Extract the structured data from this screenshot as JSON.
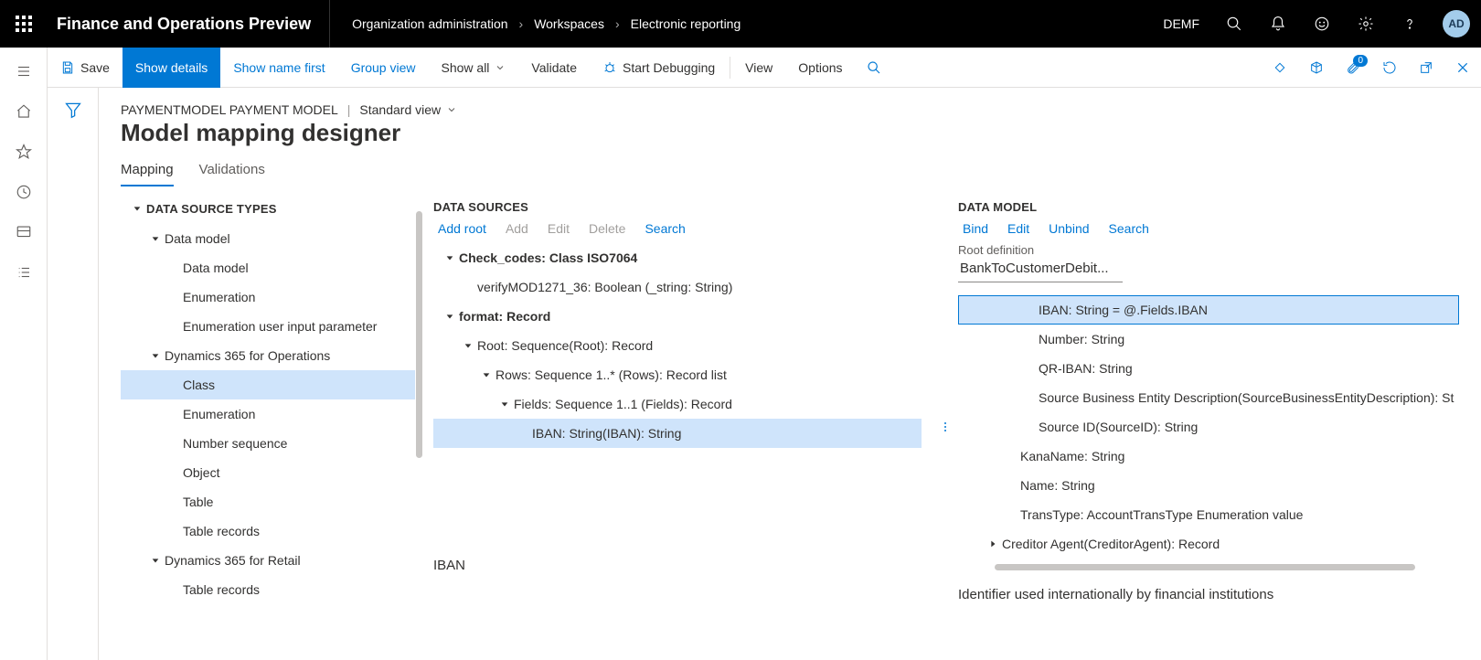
{
  "header": {
    "app_title": "Finance and Operations Preview",
    "breadcrumb": [
      "Organization administration",
      "Workspaces",
      "Electronic reporting"
    ],
    "entity": "DEMF",
    "avatar_initials": "AD"
  },
  "action_bar": {
    "save": "Save",
    "show_details": "Show details",
    "show_name_first": "Show name first",
    "group_view": "Group view",
    "show_all": "Show all",
    "validate": "Validate",
    "start_debugging": "Start Debugging",
    "view": "View",
    "options": "Options",
    "attach_badge": "0"
  },
  "page": {
    "breadcrumb_model": "PAYMENTMODEL PAYMENT MODEL",
    "view_label": "Standard view",
    "title": "Model mapping designer"
  },
  "tabs": {
    "mapping": "Mapping",
    "validations": "Validations"
  },
  "left_pane": {
    "title": "DATA SOURCE TYPES",
    "items": [
      {
        "indent": 1,
        "caret": "down",
        "bold": false,
        "label": "Data model"
      },
      {
        "indent": 2,
        "caret": "",
        "bold": false,
        "label": "Data model"
      },
      {
        "indent": 2,
        "caret": "",
        "bold": false,
        "label": "Enumeration"
      },
      {
        "indent": 2,
        "caret": "",
        "bold": false,
        "label": "Enumeration user input parameter"
      },
      {
        "indent": 1,
        "caret": "down",
        "bold": false,
        "label": "Dynamics 365 for Operations"
      },
      {
        "indent": 2,
        "caret": "",
        "bold": false,
        "label": "Class",
        "selected": true
      },
      {
        "indent": 2,
        "caret": "",
        "bold": false,
        "label": "Enumeration"
      },
      {
        "indent": 2,
        "caret": "",
        "bold": false,
        "label": "Number sequence"
      },
      {
        "indent": 2,
        "caret": "",
        "bold": false,
        "label": "Object"
      },
      {
        "indent": 2,
        "caret": "",
        "bold": false,
        "label": "Table"
      },
      {
        "indent": 2,
        "caret": "",
        "bold": false,
        "label": "Table records"
      },
      {
        "indent": 1,
        "caret": "down",
        "bold": false,
        "label": "Dynamics 365 for Retail"
      },
      {
        "indent": 2,
        "caret": "",
        "bold": false,
        "label": "Table records"
      }
    ]
  },
  "center_pane": {
    "title": "DATA SOURCES",
    "cmd": {
      "add_root": "Add root",
      "add": "Add",
      "edit": "Edit",
      "delete": "Delete",
      "search": "Search"
    },
    "tree": [
      {
        "indent": 0,
        "caret": "down",
        "bold": true,
        "label": "Check_codes: Class ISO7064"
      },
      {
        "indent": 1,
        "caret": "",
        "bold": false,
        "label": "verifyMOD1271_36: Boolean (_string: String)"
      },
      {
        "indent": 0,
        "caret": "down",
        "bold": true,
        "label": "format: Record"
      },
      {
        "indent": 1,
        "caret": "down",
        "bold": false,
        "label": "Root: Sequence(Root): Record"
      },
      {
        "indent": 2,
        "caret": "down",
        "bold": false,
        "label": "Rows: Sequence 1..* (Rows): Record list"
      },
      {
        "indent": 3,
        "caret": "down",
        "bold": false,
        "label": "Fields: Sequence 1..1 (Fields): Record"
      },
      {
        "indent": 4,
        "caret": "",
        "bold": false,
        "label": "IBAN: String(IBAN): String",
        "highlighted": true
      }
    ],
    "footer": "IBAN"
  },
  "right_pane": {
    "title": "DATA MODEL",
    "cmd": {
      "bind": "Bind",
      "edit": "Edit",
      "unbind": "Unbind",
      "search": "Search"
    },
    "root_def_label": "Root definition",
    "root_def_value": "BankToCustomerDebit...",
    "tree": [
      {
        "indent": 3,
        "caret": "",
        "label": "IBAN: String = @.Fields.IBAN",
        "highlighted": true,
        "bordered": true
      },
      {
        "indent": 3,
        "caret": "",
        "label": "Number: String"
      },
      {
        "indent": 3,
        "caret": "",
        "label": "QR-IBAN: String"
      },
      {
        "indent": 3,
        "caret": "",
        "label": "Source Business Entity Description(SourceBusinessEntityDescription): St"
      },
      {
        "indent": 3,
        "caret": "",
        "label": "Source ID(SourceID): String"
      },
      {
        "indent": 2,
        "caret": "",
        "label": "KanaName: String"
      },
      {
        "indent": 2,
        "caret": "",
        "label": "Name: String"
      },
      {
        "indent": 2,
        "caret": "",
        "label": "TransType: AccountTransType Enumeration value"
      },
      {
        "indent": 1,
        "caret": "right",
        "label": "Creditor Agent(CreditorAgent): Record"
      }
    ],
    "footer": "Identifier used internationally by financial institutions"
  }
}
